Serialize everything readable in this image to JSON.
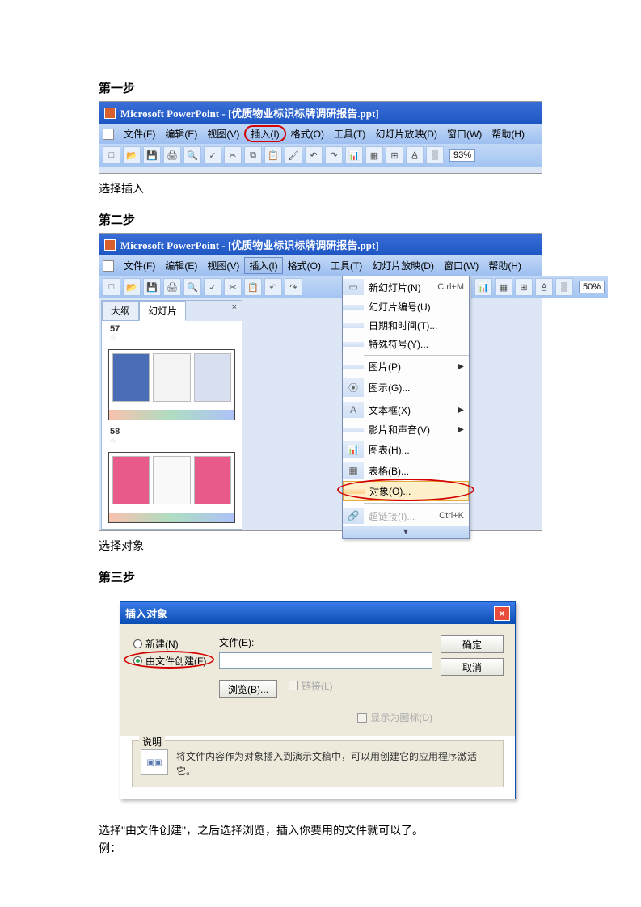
{
  "step1_title": "第一步",
  "step1_caption": "选择插入",
  "app_title1": "Microsoft PowerPoint - [优质物业标识标牌调研报告.ppt]",
  "menu": {
    "file": "文件(F)",
    "edit": "编辑(E)",
    "view": "视图(V)",
    "insert": "插入(I)",
    "format": "格式(O)",
    "tools": "工具(T)",
    "slideshow": "幻灯片放映(D)",
    "window": "窗口(W)",
    "help": "帮助(H)"
  },
  "zoom": "93%",
  "step2_title": "第二步",
  "step2_caption": "选择对象",
  "app_title2": "Microsoft PowerPoint - [优质物业标识标牌调研报告.ppt]",
  "tabs": {
    "outline": "大纲",
    "slides": "幻灯片"
  },
  "slide_nums": {
    "a": "57",
    "b": "58"
  },
  "dd": {
    "new_slide": "新幻灯片(N)",
    "new_slide_sc": "Ctrl+M",
    "slide_num": "幻灯片编号(U)",
    "datetime": "日期和时间(T)...",
    "symbol": "特殊符号(Y)...",
    "picture": "图片(P)",
    "diagram": "图示(G)...",
    "textbox": "文本框(X)",
    "movie": "影片和声音(V)",
    "chart": "图表(H)...",
    "table": "表格(B)...",
    "object": "对象(O)...",
    "hyperlink": "超链接(I)...",
    "hyperlink_sc": "Ctrl+K"
  },
  "zoom2": "50%",
  "step3_title": "第三步",
  "dlg": {
    "title": "插入对象",
    "new": "新建(N)",
    "from_file": "由文件创建(F)",
    "file_label": "文件(E):",
    "browse": "浏览(B)...",
    "link": "链接(L)",
    "ok": "确定",
    "cancel": "取消",
    "as_icon": "显示为图标(D)",
    "desc_title": "说明",
    "desc_text": "将文件内容作为对象插入到演示文稿中，可以用创建它的应用程序激活它。"
  },
  "step3_caption": "选择\"由文件创建\"，之后选择浏览，插入你要用的文件就可以了。",
  "step3_example": "例："
}
